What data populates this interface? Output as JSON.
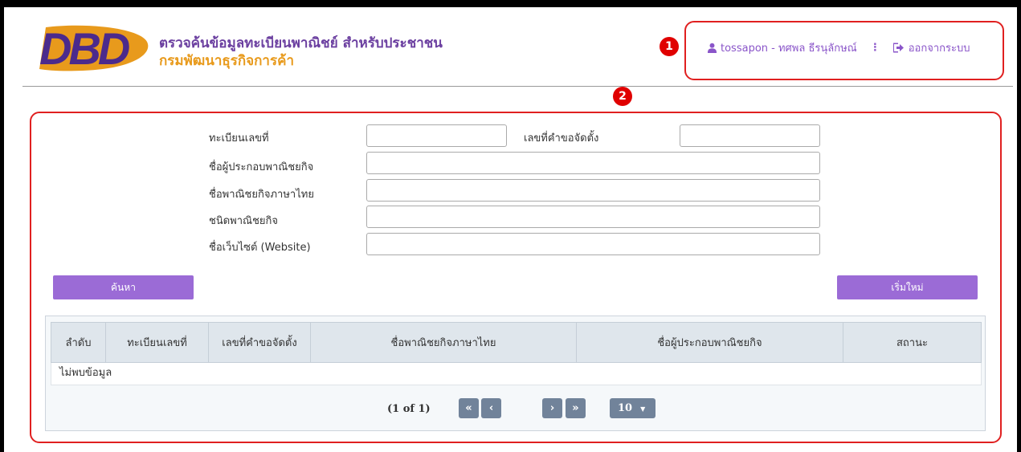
{
  "header": {
    "logo_text": "DBD",
    "title": "ตรวจค้นข้อมูลทะเบียนพาณิชย์ สำหรับประชาชน",
    "subtitle": "กรมพัฒนาธุรกิจการค้า"
  },
  "user": {
    "name": "tossapon - ทศพล ธีรนุลักษณ์",
    "separator": "⋮",
    "logout_label": "ออกจากระบบ"
  },
  "badges": {
    "one": "1",
    "two": "2"
  },
  "form": {
    "reg_no_label": "ทะเบียนเลขที่",
    "reg_no_value": "",
    "request_no_label": "เลขที่คำขอจัดตั้ง",
    "request_no_value": "",
    "operator_label": "ชื่อผู้ประกอบพาณิชยกิจ",
    "operator_value": "",
    "business_name_label": "ชื่อพาณิชยกิจภาษาไทย",
    "business_name_value": "",
    "business_type_label": "ชนิดพาณิชยกิจ",
    "business_type_value": "",
    "website_label": "ชื่อเว็บไซต์ (Website)",
    "website_value": ""
  },
  "actions": {
    "search_label": "ค้นหา",
    "reset_label": "เริ่มใหม่"
  },
  "table": {
    "headers": [
      "ลำดับ",
      "ทะเบียนเลขที่",
      "เลขที่คำขอจัดตั้ง",
      "ชื่อพาณิชยกิจภาษาไทย",
      "ชื่อผู้ประกอบพาณิชยกิจ",
      "สถานะ"
    ],
    "empty_message": "ไม่พบข้อมูล"
  },
  "pagination": {
    "page_info": "(1 of 1)",
    "first_label": "«",
    "prev_label": "‹",
    "next_label": "›",
    "last_label": "»",
    "per_page": "10"
  },
  "colors": {
    "brand_purple": "#6b3fa0",
    "brand_orange": "#e89a1c",
    "button_purple": "#9b6bd6",
    "highlight_red": "#e02020",
    "pager_gray": "#71839a"
  },
  "icons": {
    "user": "user-icon",
    "logout": "sign-out-icon"
  }
}
